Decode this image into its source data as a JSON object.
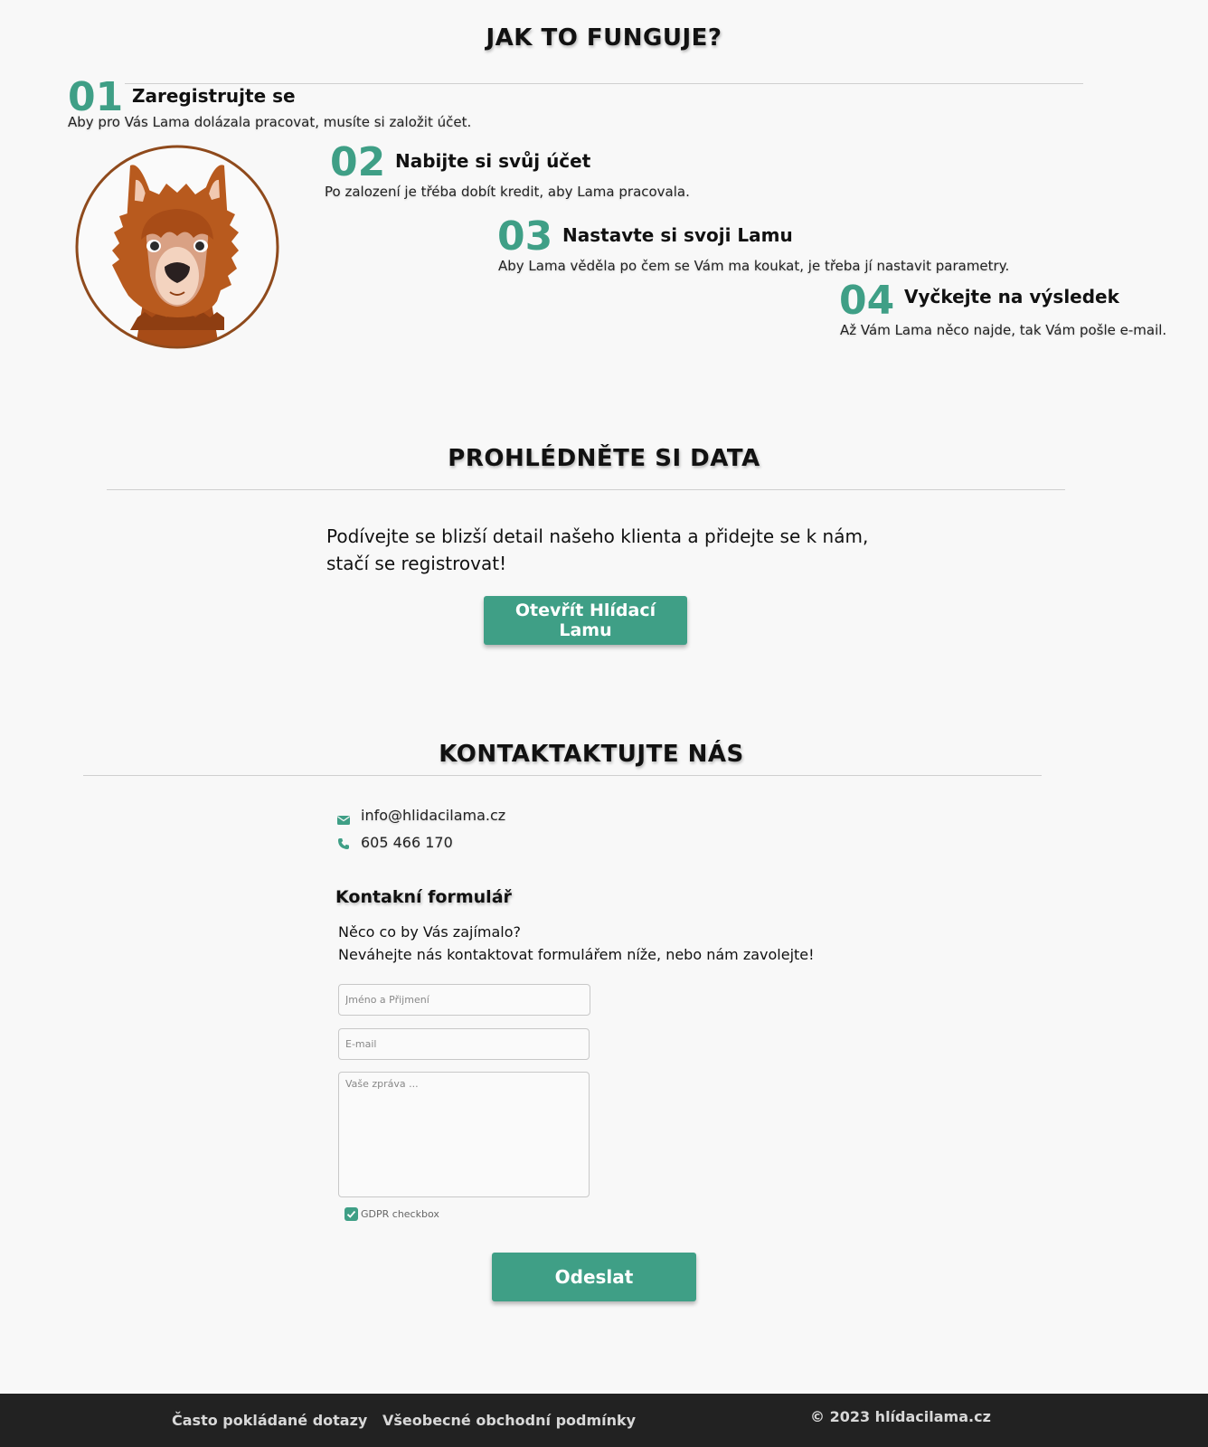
{
  "how_it_works": {
    "title": "JAK TO FUNGUJE?",
    "steps": [
      {
        "number": "01",
        "title": "Zaregistrujte se",
        "description": "Aby pro Vás Lama dolázala pracovat, musíte si založit účet."
      },
      {
        "number": "02",
        "title": "Nabijte si svůj účet",
        "description": "Po zalození je třéba dobít kredit, aby Lama pracovala."
      },
      {
        "number": "03",
        "title": "Nastavte si svoji Lamu",
        "description": "Aby Lama věděla po čem se Vám ma koukat, je třeba jí nastavit parametry."
      },
      {
        "number": "04",
        "title": "Vyčkejte na výsledek",
        "description": "Až Vám Lama něco  najde, tak Vám pošle e-mail."
      }
    ],
    "illustration": "llama-head-icon"
  },
  "data_section": {
    "title": "PROHLÉDNĚTE SI DATA",
    "text_line1": "Podívejte se blizší detail našeho klienta a přidejte se k nám,",
    "text_line2": "stačí se registrovat!",
    "button_label": "Otevřít Hlídací Lamu"
  },
  "contact": {
    "title": "KONTAKTAKTUJTE NÁS",
    "email": "info@hlidacilama.cz",
    "phone": "605 466 170",
    "email_icon": "envelope-icon",
    "phone_icon": "phone-icon",
    "form": {
      "heading": "Kontakní formulář",
      "intro_line1": "Něco co by Vás zajímalo?",
      "intro_line2": "Neváhejte nás kontaktovat formulářem níže, nebo nám zavolejte!",
      "name_placeholder": "Jméno a Přijmení",
      "email_placeholder": "E-mail",
      "message_placeholder": "Vaše zpráva ...",
      "gdpr_label": "GDPR checkbox",
      "gdpr_checked": true,
      "submit_label": "Odeslat"
    }
  },
  "footer": {
    "faq_link": "Často pokládané dotazy",
    "terms_link": "Všeobecné obchodní podmínky",
    "copyright": "© 2023 hlídacilama.cz"
  },
  "colors": {
    "accent": "#3f9f86",
    "background": "#f8f8f8",
    "footer_bg": "#222222",
    "llama_fur": "#b85a1e"
  }
}
